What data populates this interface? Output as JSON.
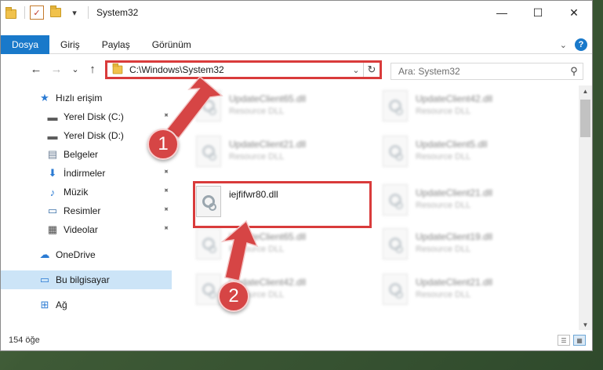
{
  "window": {
    "title": "System32",
    "controls": {
      "minimize": "—",
      "maximize": "☐",
      "close": "✕"
    }
  },
  "quick_access": {
    "properties_icon": "✓",
    "customize_icon": "▾"
  },
  "ribbon": {
    "tabs": [
      {
        "label": "Dosya",
        "active": true
      },
      {
        "label": "Giriş",
        "active": false
      },
      {
        "label": "Paylaş",
        "active": false
      },
      {
        "label": "Görünüm",
        "active": false
      }
    ],
    "expand_glyph": "⌄",
    "help_glyph": "?"
  },
  "navigation": {
    "back_glyph": "←",
    "forward_glyph": "→",
    "recent_glyph": "⌄",
    "up_glyph": "↑",
    "address": "C:\\Windows\\System32",
    "dropdown_glyph": "⌄",
    "refresh_glyph": "↻",
    "search_placeholder": "Ara: System32",
    "search_glyph": "⚲"
  },
  "sidebar": {
    "items": [
      {
        "label": "Hızlı erişim",
        "icon": "star-icon",
        "glyph": "★",
        "color": "#2b7bd3",
        "pinned": false
      },
      {
        "label": "Yerel Disk (C:)",
        "icon": "drive-icon",
        "glyph": "▬",
        "color": "#5b5b5b",
        "pinned": true
      },
      {
        "label": "Yerel Disk (D:)",
        "icon": "drive-icon",
        "glyph": "▬",
        "color": "#5b5b5b",
        "pinned": false
      },
      {
        "label": "Belgeler",
        "icon": "documents-icon",
        "glyph": "▤",
        "color": "#6d7f96",
        "pinned": true
      },
      {
        "label": "İndirmeler",
        "icon": "downloads-icon",
        "glyph": "⬇",
        "color": "#2b7bd3",
        "pinned": true
      },
      {
        "label": "Müzik",
        "icon": "music-icon",
        "glyph": "♪",
        "color": "#2b7bd3",
        "pinned": true
      },
      {
        "label": "Resimler",
        "icon": "pictures-icon",
        "glyph": "▭",
        "color": "#3a6fa8",
        "pinned": true
      },
      {
        "label": "Videolar",
        "icon": "videos-icon",
        "glyph": "▦",
        "color": "#4a4a4a",
        "pinned": true
      },
      {
        "label": "OneDrive",
        "icon": "cloud-icon",
        "glyph": "☁",
        "color": "#2b7bd3",
        "pinned": false
      },
      {
        "label": "Bu bilgisayar",
        "icon": "computer-icon",
        "glyph": "▭",
        "color": "#2b7bd3",
        "pinned": false,
        "selected": true
      },
      {
        "label": "Ağ",
        "icon": "network-icon",
        "glyph": "⊞",
        "color": "#2b7bd3",
        "pinned": false
      }
    ],
    "pin_glyph": "📌"
  },
  "files": [
    {
      "name": "UpdateClient65.dll",
      "type": "Resource DLL",
      "blurred": true
    },
    {
      "name": "UpdateClient42.dll",
      "type": "Resource DLL",
      "blurred": true
    },
    {
      "name": "UpdateClient21.dll",
      "type": "Resource DLL",
      "blurred": true
    },
    {
      "name": "UpdateClient5.dll",
      "type": "Resource DLL",
      "blurred": true
    },
    {
      "name": "iejfifwr80.dll",
      "type": "",
      "blurred": false,
      "highlighted": true
    },
    {
      "name": "UpdateClient21.dll",
      "type": "Resource DLL",
      "blurred": true
    },
    {
      "name": "UpdateClient65.dll",
      "type": "Resource DLL",
      "blurred": true
    },
    {
      "name": "UpdateClient19.dll",
      "type": "Resource DLL",
      "blurred": true
    },
    {
      "name": "UpdateClient42.dll",
      "type": "Resource DLL",
      "blurred": true
    },
    {
      "name": "UpdateClient21.dll",
      "type": "Resource DLL",
      "blurred": true
    }
  ],
  "status": {
    "item_count": "154 öğe"
  },
  "annotations": {
    "badge_1": "1",
    "badge_2": "2",
    "color": "#d64545"
  }
}
